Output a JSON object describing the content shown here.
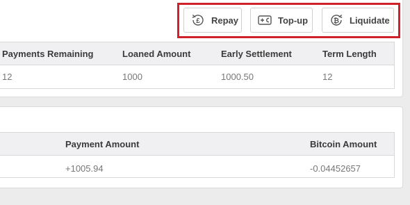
{
  "actions": {
    "repay_label": "Repay",
    "topup_label": "Top-up",
    "liquidate_label": "Liquidate"
  },
  "loan_table": {
    "headers": [
      "Payments Remaining",
      "Loaned Amount",
      "Early Settlement",
      "Term Length"
    ],
    "row": [
      "12",
      "1000",
      "1000.50",
      "12"
    ]
  },
  "payment_table": {
    "headers": [
      "Payment Amount",
      "Bitcoin Amount"
    ],
    "row": [
      "+1005.94",
      "-0.04452657"
    ]
  },
  "colors": {
    "highlight": "#d0202c",
    "background": "#ececec",
    "header_bg": "#f0f0f2"
  }
}
